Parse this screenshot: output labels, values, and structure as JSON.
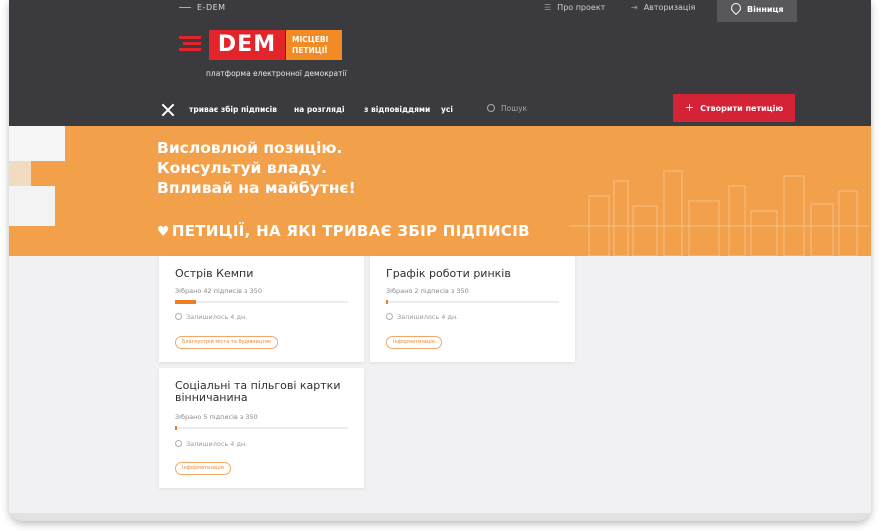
{
  "topbar": {
    "site_name": "E-DEM",
    "about_label": "Про проект",
    "login_label": "Авторизація",
    "city_label": "Вінниця"
  },
  "logo": {
    "main": "DEM",
    "sub_line1": "МІСЦЕВІ",
    "sub_line2": "ПЕТИЦІЇ",
    "tagline": "платформа електронної демократії"
  },
  "nav": {
    "tabs": [
      {
        "label": "триває збір підписів"
      },
      {
        "label": "на розгляді"
      },
      {
        "label": "з відповіддями"
      },
      {
        "label": "усі"
      }
    ],
    "search_placeholder": "Пошук",
    "create_label": "Створити петицію"
  },
  "hero": {
    "line1": "Висловлюй позицію.",
    "line2": "Консультуй владу.",
    "line3": "Впливай на майбутнє!"
  },
  "section_title": "ПЕТИЦІЇ, НА ЯКІ ТРИВАЄ ЗБІР ПІДПИСІВ",
  "petitions": [
    {
      "title": "Острів Кемпи",
      "count": "Зібрано 42 підписів з 350",
      "progress_fraction": 0.12,
      "remaining": "Залишилось 4 дн.",
      "tag": "Благоустрій міста та будівництво"
    },
    {
      "title": "Графік роботи ринків",
      "count": "Зібрано 2 підписів з 350",
      "progress_fraction": 0.006,
      "remaining": "Залишилось 4 дн.",
      "tag": "Інформатизація"
    },
    {
      "title": "Соціальні та пільгові картки вінничанина",
      "count": "Зібрано 5 підписів з 350",
      "progress_fraction": 0.014,
      "remaining": "Залишилось 4 дн.",
      "tag": "Інформатизація"
    }
  ],
  "colors": {
    "header_bg": "#3b3b3f",
    "hero_bg": "#f2a04a",
    "brand_red": "#e3242b",
    "brand_orange": "#f28b23",
    "create_button": "#d42237",
    "progress": "#ef7d22"
  }
}
